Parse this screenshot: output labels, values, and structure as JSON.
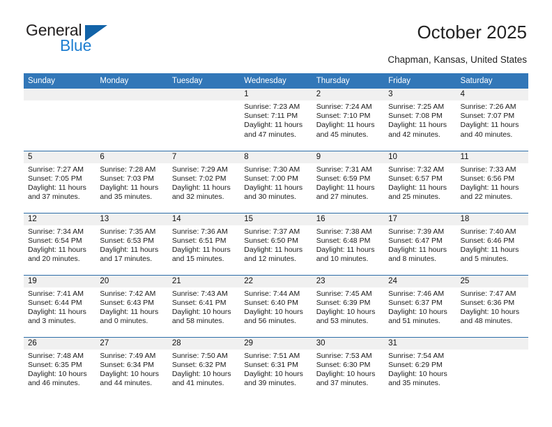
{
  "brand": {
    "name_part1": "General",
    "name_part2": "Blue",
    "triangle_color": "#1263a8",
    "blue_text_color": "#1f7fd1"
  },
  "header": {
    "title": "October 2025",
    "subtitle": "Chapman, Kansas, United States"
  },
  "theme": {
    "header_row_bg": "#3277b8",
    "day_band_bg": "#f0f0f0",
    "row_divider": "#2c6da8"
  },
  "weekday_headers": [
    "Sunday",
    "Monday",
    "Tuesday",
    "Wednesday",
    "Thursday",
    "Friday",
    "Saturday"
  ],
  "weeks": [
    [
      {
        "day": "",
        "sunrise": "",
        "sunset": "",
        "daylight": ""
      },
      {
        "day": "",
        "sunrise": "",
        "sunset": "",
        "daylight": ""
      },
      {
        "day": "",
        "sunrise": "",
        "sunset": "",
        "daylight": ""
      },
      {
        "day": "1",
        "sunrise": "Sunrise: 7:23 AM",
        "sunset": "Sunset: 7:11 PM",
        "daylight": "Daylight: 11 hours and 47 minutes."
      },
      {
        "day": "2",
        "sunrise": "Sunrise: 7:24 AM",
        "sunset": "Sunset: 7:10 PM",
        "daylight": "Daylight: 11 hours and 45 minutes."
      },
      {
        "day": "3",
        "sunrise": "Sunrise: 7:25 AM",
        "sunset": "Sunset: 7:08 PM",
        "daylight": "Daylight: 11 hours and 42 minutes."
      },
      {
        "day": "4",
        "sunrise": "Sunrise: 7:26 AM",
        "sunset": "Sunset: 7:07 PM",
        "daylight": "Daylight: 11 hours and 40 minutes."
      }
    ],
    [
      {
        "day": "5",
        "sunrise": "Sunrise: 7:27 AM",
        "sunset": "Sunset: 7:05 PM",
        "daylight": "Daylight: 11 hours and 37 minutes."
      },
      {
        "day": "6",
        "sunrise": "Sunrise: 7:28 AM",
        "sunset": "Sunset: 7:03 PM",
        "daylight": "Daylight: 11 hours and 35 minutes."
      },
      {
        "day": "7",
        "sunrise": "Sunrise: 7:29 AM",
        "sunset": "Sunset: 7:02 PM",
        "daylight": "Daylight: 11 hours and 32 minutes."
      },
      {
        "day": "8",
        "sunrise": "Sunrise: 7:30 AM",
        "sunset": "Sunset: 7:00 PM",
        "daylight": "Daylight: 11 hours and 30 minutes."
      },
      {
        "day": "9",
        "sunrise": "Sunrise: 7:31 AM",
        "sunset": "Sunset: 6:59 PM",
        "daylight": "Daylight: 11 hours and 27 minutes."
      },
      {
        "day": "10",
        "sunrise": "Sunrise: 7:32 AM",
        "sunset": "Sunset: 6:57 PM",
        "daylight": "Daylight: 11 hours and 25 minutes."
      },
      {
        "day": "11",
        "sunrise": "Sunrise: 7:33 AM",
        "sunset": "Sunset: 6:56 PM",
        "daylight": "Daylight: 11 hours and 22 minutes."
      }
    ],
    [
      {
        "day": "12",
        "sunrise": "Sunrise: 7:34 AM",
        "sunset": "Sunset: 6:54 PM",
        "daylight": "Daylight: 11 hours and 20 minutes."
      },
      {
        "day": "13",
        "sunrise": "Sunrise: 7:35 AM",
        "sunset": "Sunset: 6:53 PM",
        "daylight": "Daylight: 11 hours and 17 minutes."
      },
      {
        "day": "14",
        "sunrise": "Sunrise: 7:36 AM",
        "sunset": "Sunset: 6:51 PM",
        "daylight": "Daylight: 11 hours and 15 minutes."
      },
      {
        "day": "15",
        "sunrise": "Sunrise: 7:37 AM",
        "sunset": "Sunset: 6:50 PM",
        "daylight": "Daylight: 11 hours and 12 minutes."
      },
      {
        "day": "16",
        "sunrise": "Sunrise: 7:38 AM",
        "sunset": "Sunset: 6:48 PM",
        "daylight": "Daylight: 11 hours and 10 minutes."
      },
      {
        "day": "17",
        "sunrise": "Sunrise: 7:39 AM",
        "sunset": "Sunset: 6:47 PM",
        "daylight": "Daylight: 11 hours and 8 minutes."
      },
      {
        "day": "18",
        "sunrise": "Sunrise: 7:40 AM",
        "sunset": "Sunset: 6:46 PM",
        "daylight": "Daylight: 11 hours and 5 minutes."
      }
    ],
    [
      {
        "day": "19",
        "sunrise": "Sunrise: 7:41 AM",
        "sunset": "Sunset: 6:44 PM",
        "daylight": "Daylight: 11 hours and 3 minutes."
      },
      {
        "day": "20",
        "sunrise": "Sunrise: 7:42 AM",
        "sunset": "Sunset: 6:43 PM",
        "daylight": "Daylight: 11 hours and 0 minutes."
      },
      {
        "day": "21",
        "sunrise": "Sunrise: 7:43 AM",
        "sunset": "Sunset: 6:41 PM",
        "daylight": "Daylight: 10 hours and 58 minutes."
      },
      {
        "day": "22",
        "sunrise": "Sunrise: 7:44 AM",
        "sunset": "Sunset: 6:40 PM",
        "daylight": "Daylight: 10 hours and 56 minutes."
      },
      {
        "day": "23",
        "sunrise": "Sunrise: 7:45 AM",
        "sunset": "Sunset: 6:39 PM",
        "daylight": "Daylight: 10 hours and 53 minutes."
      },
      {
        "day": "24",
        "sunrise": "Sunrise: 7:46 AM",
        "sunset": "Sunset: 6:37 PM",
        "daylight": "Daylight: 10 hours and 51 minutes."
      },
      {
        "day": "25",
        "sunrise": "Sunrise: 7:47 AM",
        "sunset": "Sunset: 6:36 PM",
        "daylight": "Daylight: 10 hours and 48 minutes."
      }
    ],
    [
      {
        "day": "26",
        "sunrise": "Sunrise: 7:48 AM",
        "sunset": "Sunset: 6:35 PM",
        "daylight": "Daylight: 10 hours and 46 minutes."
      },
      {
        "day": "27",
        "sunrise": "Sunrise: 7:49 AM",
        "sunset": "Sunset: 6:34 PM",
        "daylight": "Daylight: 10 hours and 44 minutes."
      },
      {
        "day": "28",
        "sunrise": "Sunrise: 7:50 AM",
        "sunset": "Sunset: 6:32 PM",
        "daylight": "Daylight: 10 hours and 41 minutes."
      },
      {
        "day": "29",
        "sunrise": "Sunrise: 7:51 AM",
        "sunset": "Sunset: 6:31 PM",
        "daylight": "Daylight: 10 hours and 39 minutes."
      },
      {
        "day": "30",
        "sunrise": "Sunrise: 7:53 AM",
        "sunset": "Sunset: 6:30 PM",
        "daylight": "Daylight: 10 hours and 37 minutes."
      },
      {
        "day": "31",
        "sunrise": "Sunrise: 7:54 AM",
        "sunset": "Sunset: 6:29 PM",
        "daylight": "Daylight: 10 hours and 35 minutes."
      },
      {
        "day": "",
        "sunrise": "",
        "sunset": "",
        "daylight": ""
      }
    ]
  ]
}
